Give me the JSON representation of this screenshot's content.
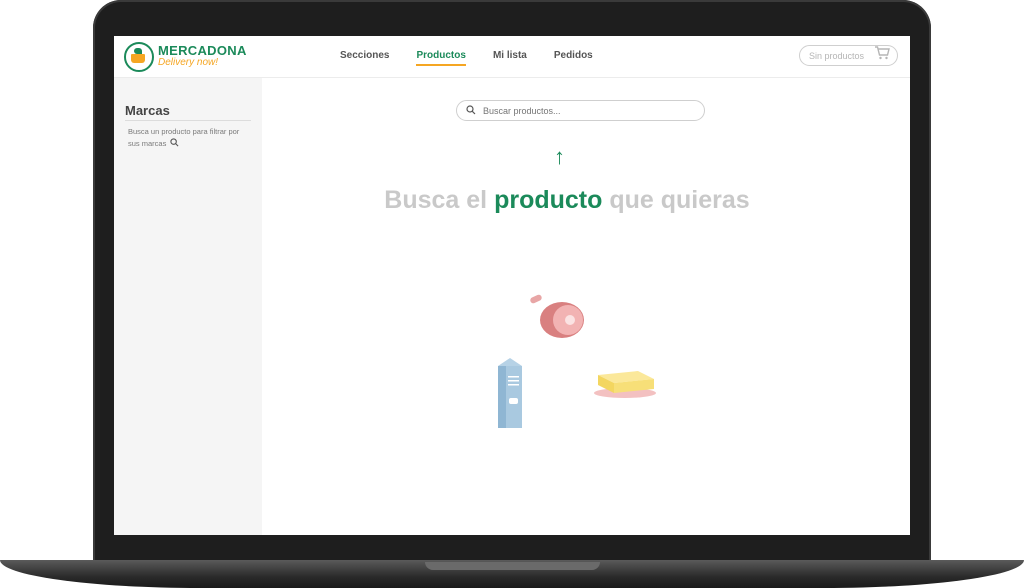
{
  "brand": {
    "name": "MERCADONA",
    "tagline": "Delivery now!",
    "primary_color": "#1b8a5a",
    "accent_color": "#f5a623"
  },
  "nav": {
    "items": [
      {
        "label": "Secciones",
        "active": false
      },
      {
        "label": "Productos",
        "active": true
      },
      {
        "label": "Mi lista",
        "active": false
      },
      {
        "label": "Pedidos",
        "active": false
      }
    ]
  },
  "cart": {
    "label": "Sin productos",
    "icon": "cart-icon"
  },
  "sidebar": {
    "title": "Marcas",
    "hint": "Busca un producto para filtrar por sus marcas"
  },
  "search": {
    "placeholder": "Buscar productos..."
  },
  "headline": {
    "part1": "Busca el",
    "accent": "producto",
    "part2": "que quieras"
  }
}
